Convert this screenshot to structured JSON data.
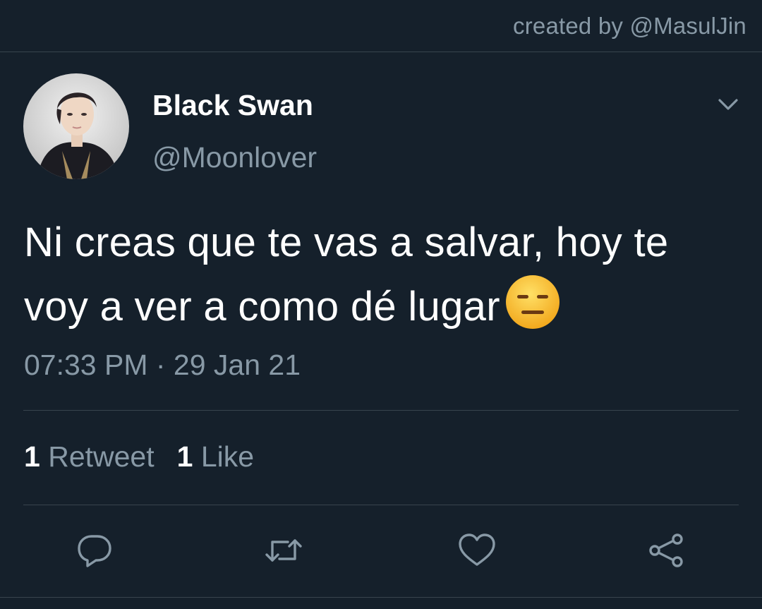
{
  "watermark": {
    "credit": "created by @MasulJin"
  },
  "tweet": {
    "author": {
      "display_name": "Black Swan",
      "handle": "@Moonlover",
      "avatar": "avatar-photo"
    },
    "text": "Ni creas que te vas a salvar, hoy te voy a ver a como dé lugar",
    "emoji": "expressionless-face-emoji",
    "timestamp": "07:33 PM · 29 Jan 21",
    "stats": {
      "retweets_count": "1",
      "retweets_label": "Retweet",
      "likes_count": "1",
      "likes_label": "Like"
    },
    "actions": [
      "reply-icon",
      "retweet-icon",
      "like-icon",
      "share-icon"
    ],
    "menu_icon": "chevron-down-icon"
  },
  "colors": {
    "background": "#15202b",
    "secondary_text": "#8899a6",
    "divider": "#38444d",
    "primary_text": "#ffffff"
  }
}
